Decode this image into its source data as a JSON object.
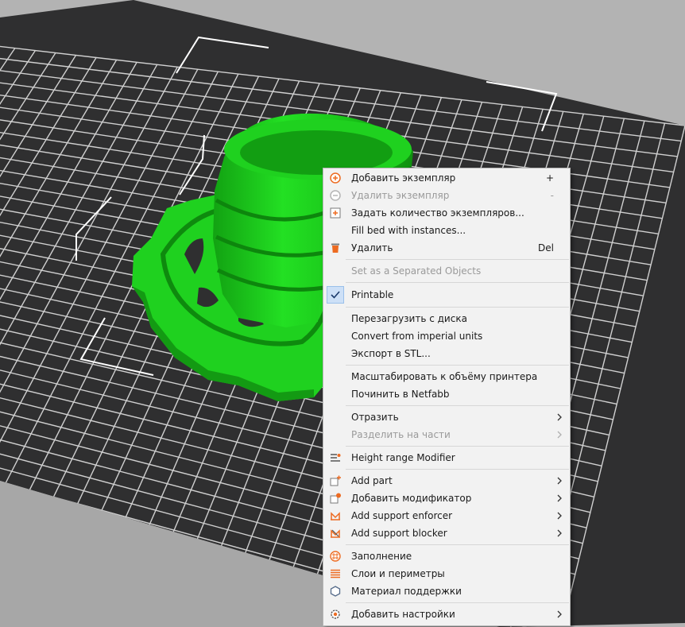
{
  "menu": {
    "items": [
      {
        "label": "Добавить экземпляр",
        "shortcut": "+",
        "icon": "add-circle-icon"
      },
      {
        "label": "Удалить экземпляр",
        "shortcut": "-",
        "icon": "remove-circle-icon",
        "disabled": true
      },
      {
        "label": "Задать количество экземпляров...",
        "icon": "instances-number-icon"
      },
      {
        "label": "Fill bed with instances..."
      },
      {
        "label": "Удалить",
        "shortcut": "Del",
        "icon": "trash-icon"
      },
      {
        "label": "Set as a Separated Objects",
        "disabled": true
      },
      {
        "label": "Printable",
        "checked": true,
        "icon": "check-icon"
      },
      {
        "label": "Перезагрузить с диска"
      },
      {
        "label": "Convert from imperial units"
      },
      {
        "label": "Экспорт в STL..."
      },
      {
        "label": "Масштабировать к объёму принтера"
      },
      {
        "label": "Починить в Netfabb"
      },
      {
        "label": "Отразить",
        "submenu": true
      },
      {
        "label": "Разделить на части",
        "submenu": true,
        "disabled": true
      },
      {
        "label": "Height range Modifier",
        "icon": "height-range-icon"
      },
      {
        "label": "Add part",
        "submenu": true,
        "icon": "add-part-icon"
      },
      {
        "label": "Добавить модификатор",
        "submenu": true,
        "icon": "add-modifier-icon"
      },
      {
        "label": "Add support enforcer",
        "submenu": true,
        "icon": "support-enforcer-icon"
      },
      {
        "label": "Add support blocker",
        "submenu": true,
        "icon": "support-blocker-icon"
      },
      {
        "label": "Заполнение",
        "icon": "infill-icon"
      },
      {
        "label": "Слои и периметры",
        "icon": "layers-icon"
      },
      {
        "label": "Материал поддержки",
        "icon": "support-material-icon"
      },
      {
        "label": "Добавить настройки",
        "submenu": true,
        "icon": "settings-icon"
      }
    ]
  },
  "colors": {
    "bed": "#2f2f30",
    "grid_line": "#d0d0d0",
    "background": "#b3b3b3",
    "model_green": "#1fd11f",
    "accent_orange": "#ed6b21"
  }
}
